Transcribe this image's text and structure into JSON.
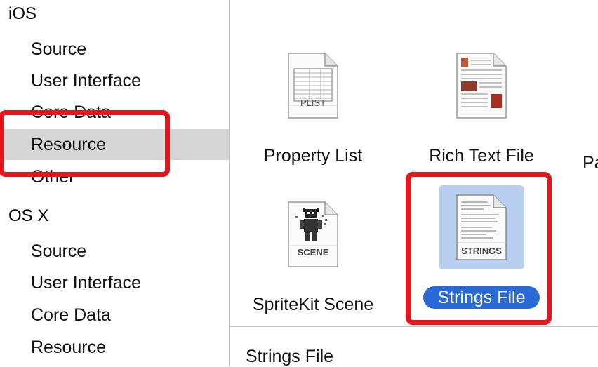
{
  "sidebar": {
    "sections": [
      {
        "title": "iOS",
        "items": [
          {
            "label": "Source"
          },
          {
            "label": "User Interface"
          },
          {
            "label": "Core Data"
          },
          {
            "label": "Resource"
          },
          {
            "label": "Other"
          }
        ]
      },
      {
        "title": "OS X",
        "items": [
          {
            "label": "Source"
          },
          {
            "label": "User Interface"
          },
          {
            "label": "Core Data"
          },
          {
            "label": "Resource"
          }
        ]
      }
    ],
    "selected": "iOS / Resource"
  },
  "templates": [
    {
      "label": "Property List",
      "icon": "plist-file-icon",
      "badge": "PLIST"
    },
    {
      "label": "Rich Text File",
      "icon": "rich-text-file-icon"
    },
    {
      "label": "SpriteKit Scene",
      "icon": "spritekit-scene-file-icon",
      "badge": "SCENE"
    },
    {
      "label": "Strings File",
      "icon": "strings-file-icon",
      "badge": "STRINGS",
      "selected": true
    }
  ],
  "partial_label": "Pa",
  "details": {
    "title": "Strings File"
  },
  "colors": {
    "selection_blue": "#2a6ad7",
    "icon_selection_bg": "#b9cff0",
    "sidebar_selected_bg": "#d5d5d5",
    "annotation_red": "#e8141c"
  }
}
